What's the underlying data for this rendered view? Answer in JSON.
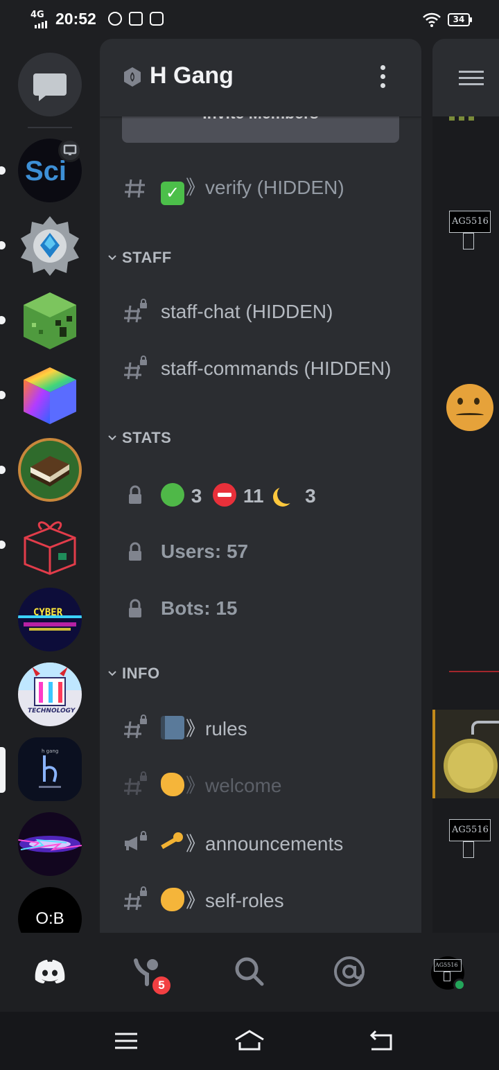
{
  "status_bar": {
    "network": "4G",
    "time": "20:52",
    "battery": "34"
  },
  "server": {
    "name": "H Gang",
    "invite_label": "Invite Members"
  },
  "rail": {
    "items": [
      {
        "name": "Sci"
      },
      {
        "name": "gear-gem"
      },
      {
        "name": "creeper"
      },
      {
        "name": "rainbow-cube"
      },
      {
        "name": "book"
      },
      {
        "name": "gift"
      },
      {
        "name": "CYBER"
      },
      {
        "name": "TECHNOLOGY"
      },
      {
        "name": "h gang"
      },
      {
        "name": "energy"
      },
      {
        "name": "O:B"
      }
    ],
    "last_label": "O:B"
  },
  "channels": {
    "verify": "》verify (HIDDEN)",
    "categories": {
      "staff": "STAFF",
      "stats": "STATS",
      "info": "INFO"
    },
    "staff_chat": "staff-chat (HIDDEN)",
    "staff_commands": "staff-commands (HIDDEN)",
    "stats_online": "3",
    "stats_dnd": "11",
    "stats_idle": "3",
    "users": "Users: 57",
    "bots": "Bots: 15",
    "rules": "》rules",
    "welcome": "》welcome",
    "announcements": "》announcements",
    "self_roles": "》self-roles"
  },
  "peek": {
    "tag1": "AG5516",
    "tag2": "AG5516"
  },
  "bottom_nav": {
    "friends_badge": "5",
    "avatar_tag": "AG5516"
  },
  "colors": {
    "background": "#1e1f22",
    "panel": "#2b2d31",
    "badge": "#f23f42",
    "online": "#23a55a"
  }
}
